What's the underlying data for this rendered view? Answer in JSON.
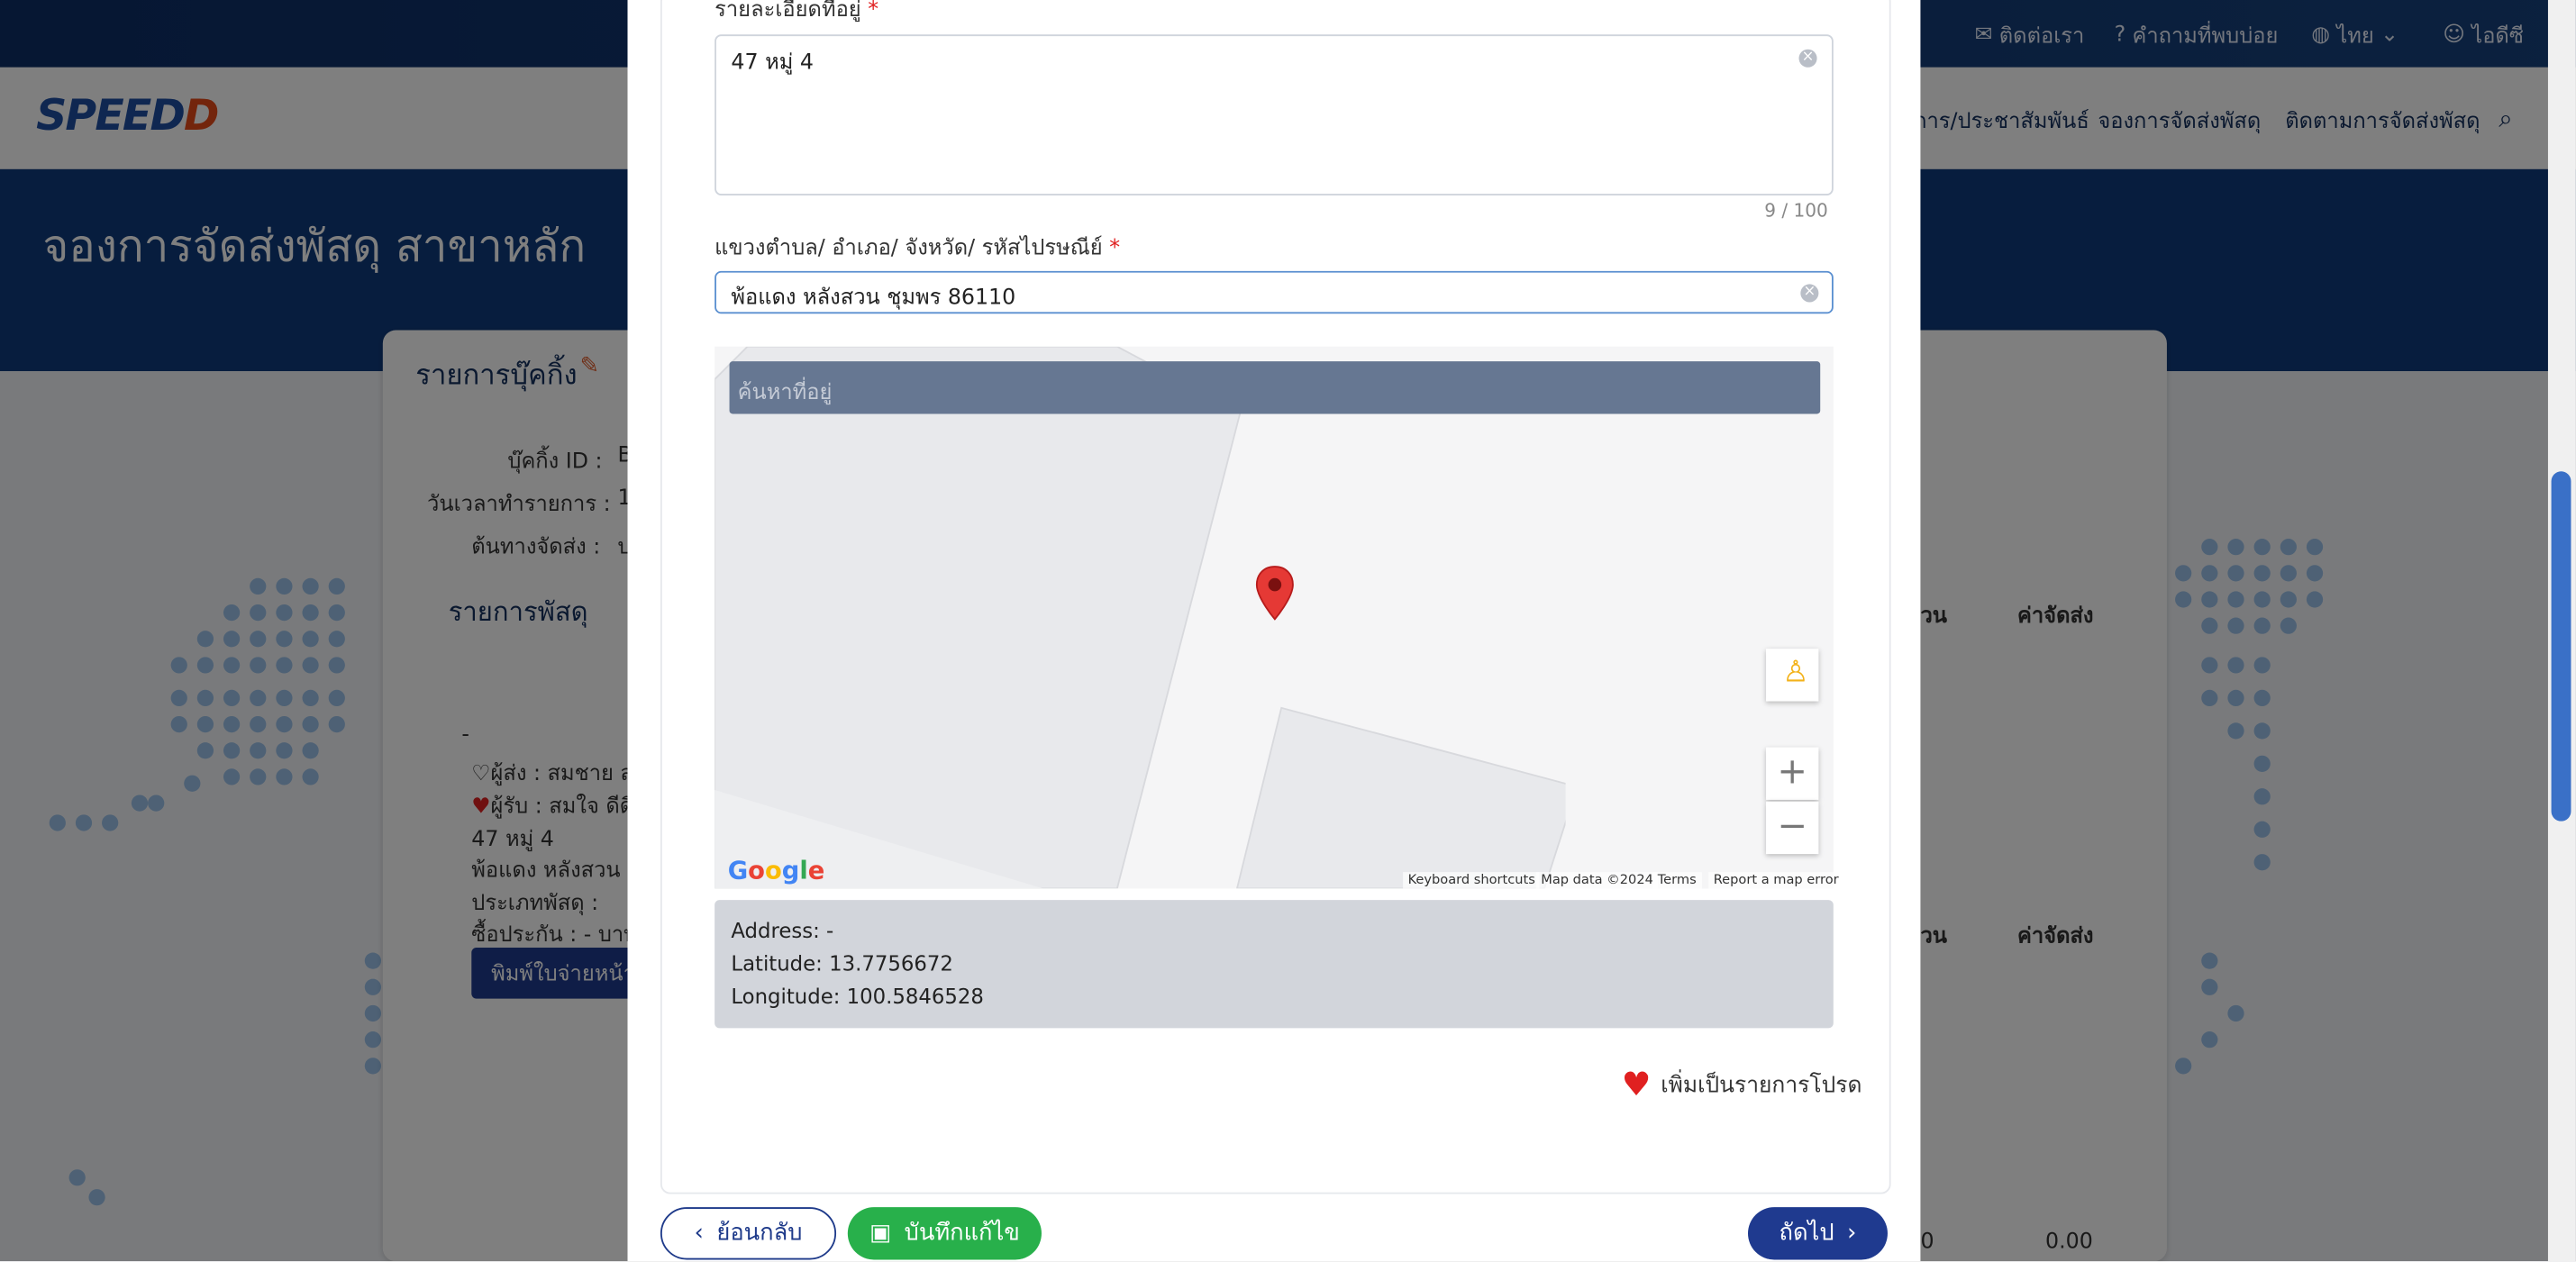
{
  "topbar": {
    "contact": "ติดต่อเรา",
    "faq": "คำถามที่พบบ่อย",
    "lang": "ไทย",
    "user": "ไอดีซี"
  },
  "nav": {
    "logo_main": "SPEED",
    "logo_accent": "D",
    "link1": "การ/ประชาสัมพันธ์",
    "link2": "จองการจัดส่งพัสดุ",
    "link3": "ติดตามการจัดส่งพัสดุ"
  },
  "hero": {
    "title": "จองการจัดส่งพัสดุ สาขาหลัก"
  },
  "background": {
    "booking_list": "รายการบุ๊คกิ้ง",
    "booking_id": "บุ๊คกิ้ง ID :",
    "booking_id_val": "B",
    "datetime": "วันเวลาทำรายการ :",
    "datetime_val": "1",
    "origin": "ต้นทางจัดส่ง :",
    "origin_val": "บ",
    "parcel_list": "รายการพัสดุ",
    "dash": "-",
    "sender": "ผู้ส่ง :",
    "sender_val": "สมชาย ส",
    "receiver": "ผู้รับ :",
    "receiver_val": "สมใจ ดีดี",
    "addr1": "47 หมู่ 4",
    "addr2": "พ้อแดง หลังสวน ชุ",
    "parcel_type": "ประเภทพัสดุ :",
    "insurance": "ซื้อประกัน : - บาท",
    "print_btn": "พิมพ์ใบจ่ายหน้า",
    "col_qty": "วน",
    "col_fee": "ค่าจัดส่ง",
    "col_qty2": "วน",
    "col_fee2": "ค่าจัดส่ง",
    "zero_a": "0",
    "zero_b": "0.00"
  },
  "form": {
    "address_label": "รายละเอียดที่อยู่",
    "address_value": "47 หมู่ 4",
    "counter": "9 / 100",
    "region_label": "แขวงตำบล/ อำเภอ/ จังหวัด/ รหัสไปรษณีย์",
    "region_value": "พ้อแดง หลังสวน ชุมพร 86110",
    "map_search_placeholder": "ค้นหาที่อยู่"
  },
  "map": {
    "logo": "Google",
    "keyboard": "Keyboard shortcuts",
    "mapdata": "Map data ©2024",
    "terms": "Terms",
    "report": "Report a map error",
    "zoom_in": "+",
    "zoom_out": "−"
  },
  "location": {
    "address": "Address: -",
    "latitude": "Latitude: 13.7756672",
    "longitude": "Longitude: 100.5846528"
  },
  "favorite": "เพิ่มเป็นรายการโปรด",
  "buttons": {
    "back": "ย้อนกลับ",
    "save": "บันทึกแก้ไข",
    "next": "ถัดไป"
  },
  "colors": {
    "primary": "#1f3a8f",
    "save": "#28b04b",
    "heart": "#e02020"
  }
}
